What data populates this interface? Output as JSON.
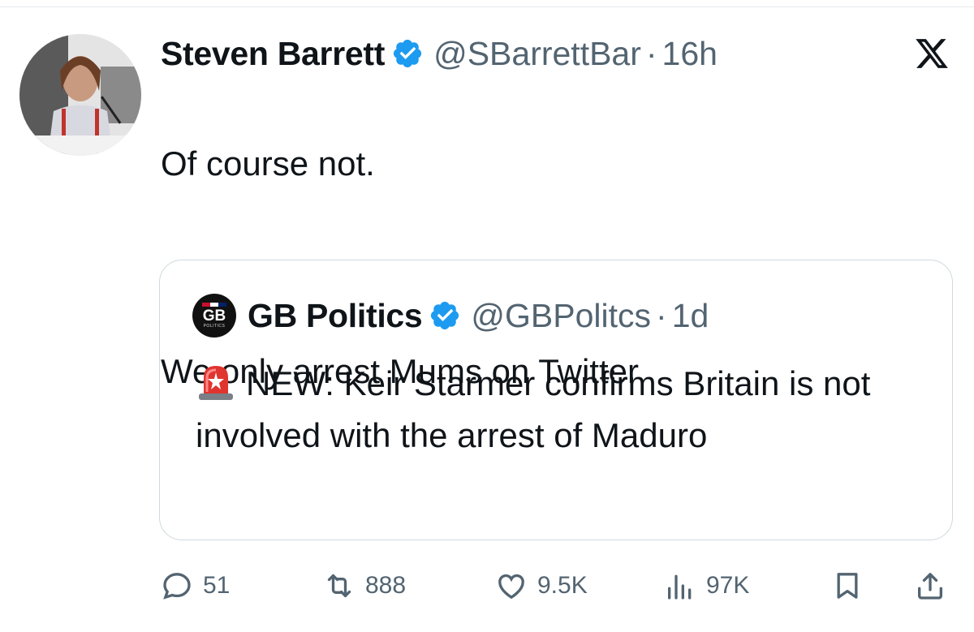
{
  "tweet": {
    "author_name": "Steven Barrett",
    "author_handle": "@SBarrettBar",
    "separator": "·",
    "time": "16h",
    "text_line1": "Of course not.",
    "text_line2": "We only arrest Mums on Twitter"
  },
  "quote": {
    "avatar_text": "GB",
    "avatar_subtext": "POLITICS",
    "author_name": "GB Politics",
    "author_handle": "@GBPolitcs",
    "separator": "·",
    "time": "1d",
    "text": "NEW: Keir Starmer confirms Britain is not involved with the arrest of Maduro"
  },
  "actions": {
    "replies": "51",
    "reposts": "888",
    "likes": "9.5K",
    "views": "97K"
  },
  "colors": {
    "verified": "#1d9bf0",
    "secondary_text": "#536471",
    "border": "#cfd9de"
  },
  "icons": [
    "verified-badge-icon",
    "x-logo-icon",
    "siren-emoji-icon",
    "reply-icon",
    "repost-icon",
    "like-icon",
    "views-icon",
    "bookmark-icon",
    "share-icon"
  ]
}
